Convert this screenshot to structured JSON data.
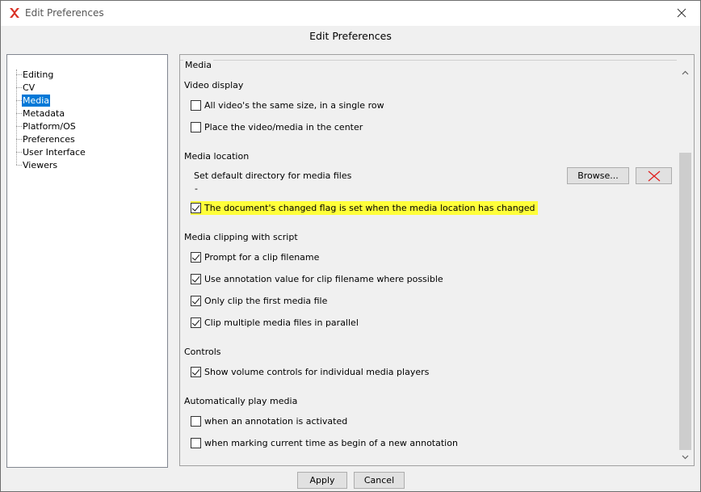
{
  "window": {
    "title": "Edit Preferences"
  },
  "dialog": {
    "header": "Edit Preferences"
  },
  "tree": {
    "items": [
      {
        "label": "Editing"
      },
      {
        "label": "CV"
      },
      {
        "label": "Media",
        "selected": true
      },
      {
        "label": "Metadata"
      },
      {
        "label": "Platform/OS"
      },
      {
        "label": "Preferences"
      },
      {
        "label": "User Interface"
      },
      {
        "label": "Viewers"
      }
    ]
  },
  "panel": {
    "legend": "Media",
    "video_display": {
      "label": "Video display",
      "options": [
        {
          "label": "All video's the same size, in a single row",
          "checked": false
        },
        {
          "label": "Place the video/media in the center",
          "checked": false
        }
      ]
    },
    "media_location": {
      "label": "Media location",
      "default_dir_label": "Set default directory for media files",
      "default_dir_value": "-",
      "browse_label": "Browse...",
      "changed_flag": {
        "label": "The document's changed flag is set when the media location has changed",
        "checked": true
      }
    },
    "media_clipping": {
      "label": "Media clipping with script",
      "options": [
        {
          "label": "Prompt for a clip filename",
          "checked": true
        },
        {
          "label": "Use annotation value for clip filename where possible",
          "checked": true
        },
        {
          "label": "Only clip the first media file",
          "checked": true
        },
        {
          "label": "Clip multiple media files in parallel",
          "checked": true
        }
      ]
    },
    "controls": {
      "label": "Controls",
      "options": [
        {
          "label": "Show volume controls for individual media players",
          "checked": true
        }
      ]
    },
    "autoplay": {
      "label": "Automatically play media",
      "options": [
        {
          "label": "when an annotation is activated",
          "checked": false
        },
        {
          "label": "when marking current time as begin of a new annotation",
          "checked": false
        }
      ]
    }
  },
  "footer": {
    "apply_label": "Apply",
    "cancel_label": "Cancel"
  },
  "colors": {
    "selection": "#0078d7",
    "highlight": "#ffff3a",
    "clear_icon": "#e02020"
  }
}
